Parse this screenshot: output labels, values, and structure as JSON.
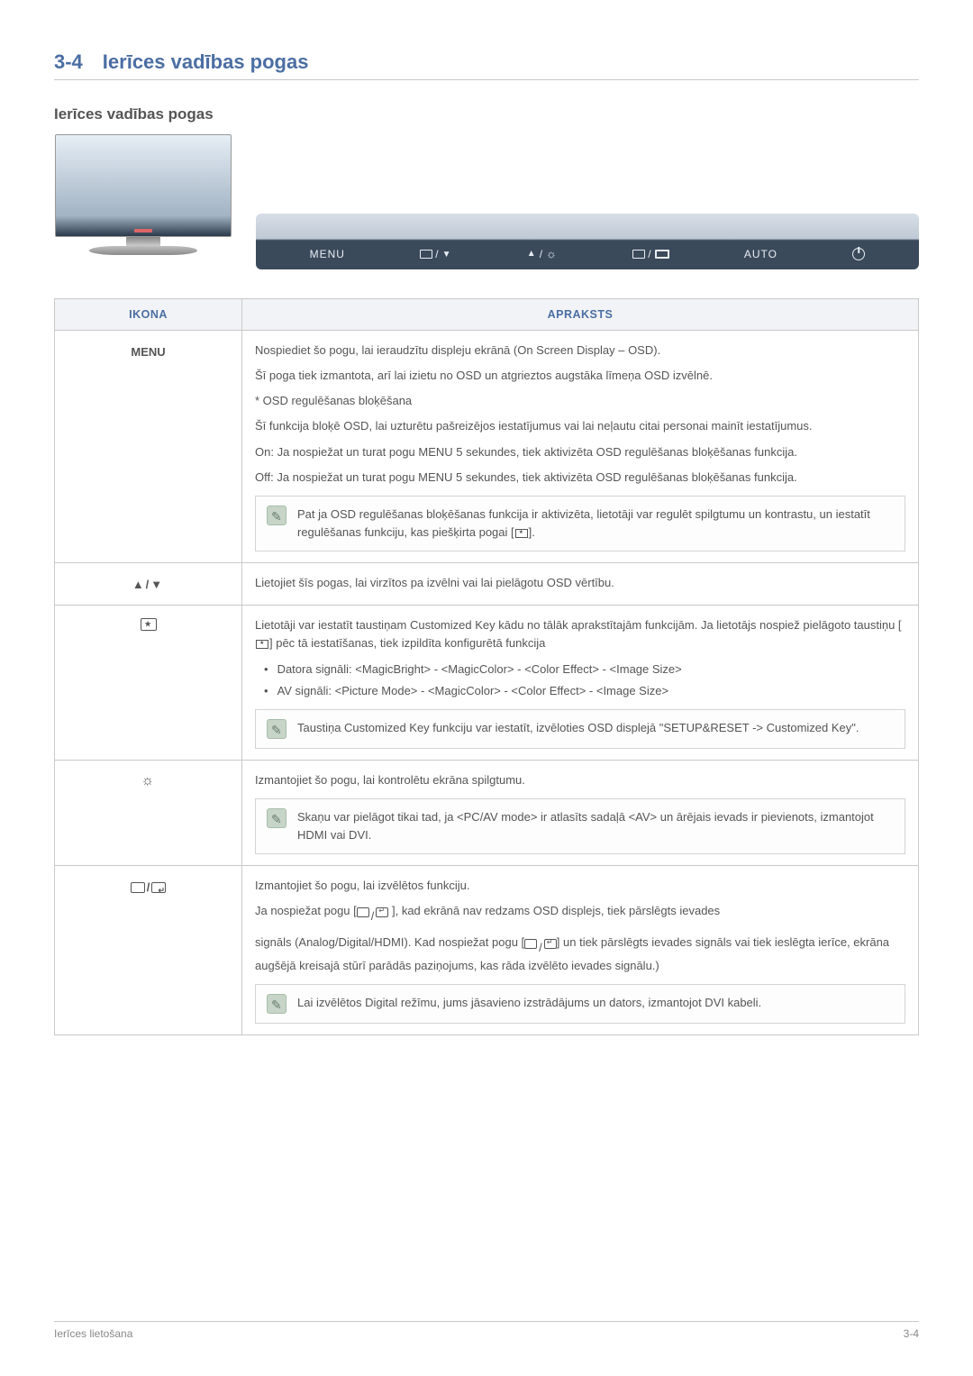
{
  "section": {
    "num": "3-4",
    "title": "Ierīces vadības pogas"
  },
  "sub_heading": "Ierīces vadības pogas",
  "button_strip": {
    "menu": "MENU",
    "auto": "AUTO"
  },
  "table": {
    "headers": {
      "icon": "IKONA",
      "desc": "APRAKSTS"
    },
    "rows": {
      "menu": {
        "label": "MENU",
        "p1": "Nospiediet šo pogu, lai ieraudzītu displeju ekrānā (On Screen Display – OSD).",
        "p2": "Šī poga tiek izmantota, arī lai izietu no OSD un atgrieztos augstāka līmeņa OSD izvēlnē.",
        "p3": "* OSD regulēšanas bloķēšana",
        "p4": "Šī funkcija bloķē OSD, lai uzturētu pašreizējos iestatījumus vai lai neļautu citai personai mainīt iestatījumus.",
        "p5": "On: Ja nospiežat un turat pogu MENU 5 sekundes, tiek aktivizēta OSD regulēšanas bloķēšanas funkcija.",
        "p6": "Off: Ja nospiežat un turat pogu MENU 5 sekundes, tiek aktivizēta OSD regulēšanas bloķēšanas funkcija.",
        "note_a": "Pat ja OSD regulēšanas bloķēšanas funkcija ir aktivizēta, lietotāji var regulēt spilgtumu un kontrastu, un iestatīt regulēšanas funkciju, kas piešķirta pogai [",
        "note_b": "]."
      },
      "arrows": {
        "label": "▲/▼",
        "p1": "Lietojiet šīs pogas, lai virzītos pa izvēlni vai lai pielāgotu OSD vērtību."
      },
      "custom": {
        "p1a": "Lietotāji var iestatīt taustiņam Customized Key kādu no tālāk aprakstītajām funkcijām. Ja lietotājs nospiež pielāgoto taustiņu [",
        "p1b": "] pēc tā iestatīšanas, tiek izpildīta konfigurētā funkcija",
        "b1": "Datora signāli: <MagicBright> - <MagicColor> - <Color Effect> - <Image Size>",
        "b2": "AV signāli: <Picture Mode> - <MagicColor> - <Color Effect> - <Image Size>",
        "note": "Taustiņa Customized Key funkciju var iestatīt, izvēloties OSD displejā \"SETUP&RESET -> Customized Key\"."
      },
      "bright": {
        "p1": "Izmantojiet šo pogu, lai kontrolētu ekrāna spilgtumu.",
        "note": "Skaņu var pielāgot tikai tad, ja <PC/AV mode> ir atlasīts sadaļā <AV> un ārējais ievads ir pievienots, izmantojot HDMI vai DVI."
      },
      "source": {
        "p1": "Izmantojiet šo pogu, lai izvēlētos funkciju.",
        "p2a": "Ja nospiežat pogu [",
        "p2b": " ], kad ekrānā nav redzams OSD displejs, tiek pārslēgts ievades",
        "p3a": "signāls (Analog/Digital/HDMI). Kad nospiežat pogu [",
        "p3b": "] un tiek pārslēgts ievades signāls vai tiek ieslēgta ierīce, ekrāna augšējā kreisajā stūrī parādās paziņojums, kas rāda izvēlēto ievades signālu.)",
        "note": "Lai izvēlētos Digital režīmu, jums jāsavieno izstrādājums un dators, izmantojot DVI kabeli."
      }
    }
  },
  "footer": {
    "left": "Ierīces lietošana",
    "right": "3-4"
  }
}
